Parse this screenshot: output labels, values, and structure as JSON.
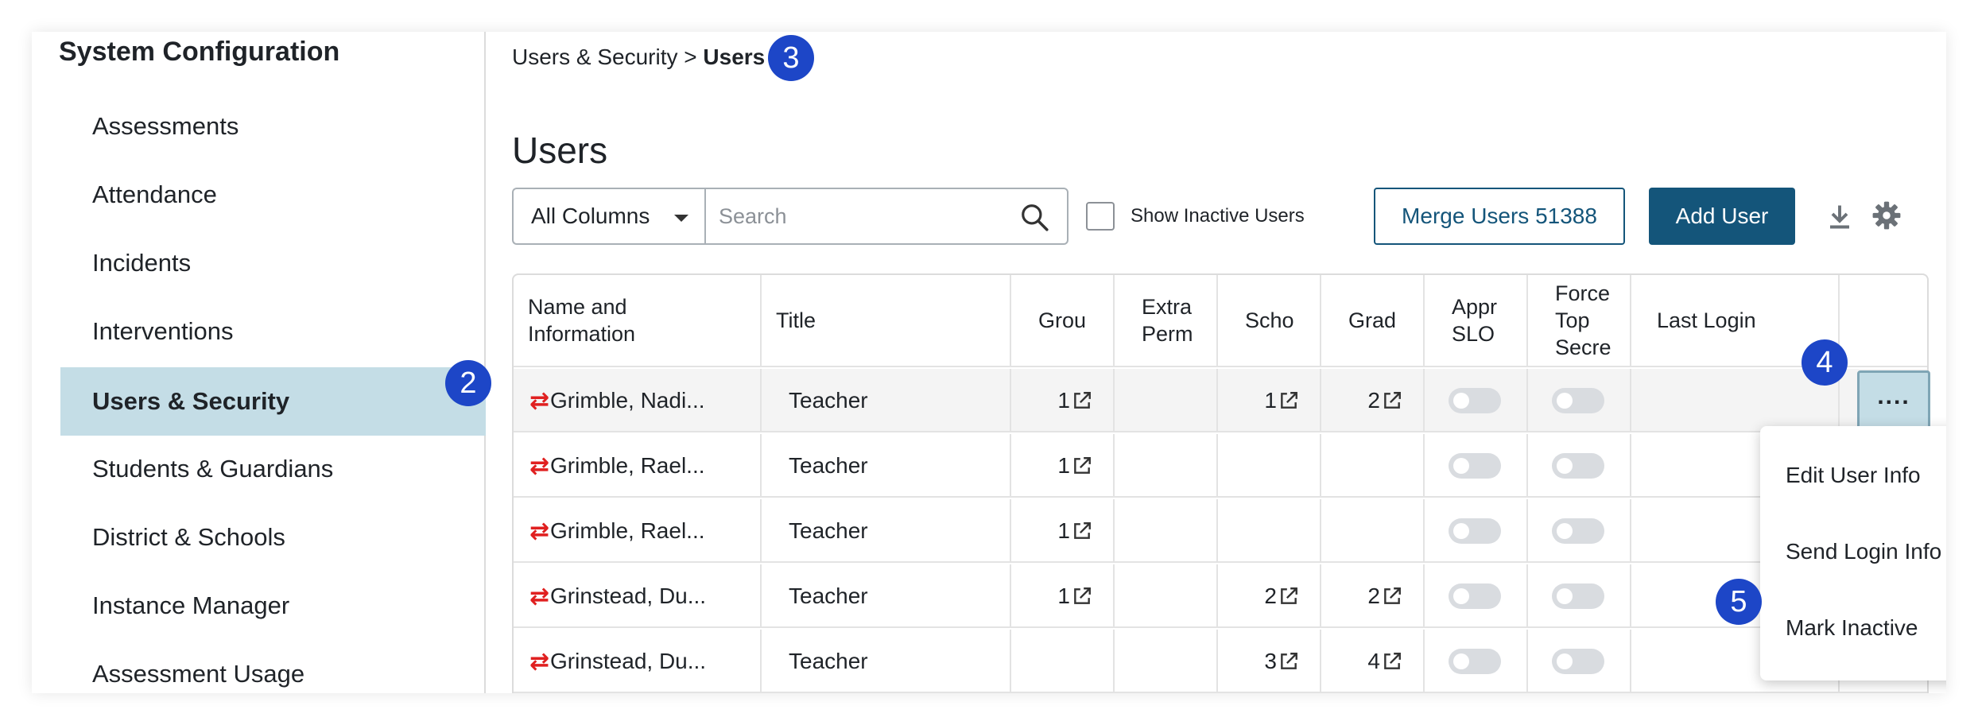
{
  "sidebar": {
    "title": "System Configuration",
    "items": [
      {
        "label": "Assessments"
      },
      {
        "label": "Attendance"
      },
      {
        "label": "Incidents"
      },
      {
        "label": "Interventions"
      },
      {
        "label": "Users & Security"
      },
      {
        "label": "Students & Guardians"
      },
      {
        "label": "District & Schools"
      },
      {
        "label": "Instance Manager"
      },
      {
        "label": "Assessment Usage"
      }
    ],
    "active_item": "Users & Security"
  },
  "breadcrumb": {
    "parent": "Users & Security",
    "separator": ">",
    "current": "Users"
  },
  "page_title": "Users",
  "toolbar": {
    "column_filter": "All Columns",
    "search_placeholder": "Search",
    "show_inactive_label": "Show Inactive Users",
    "merge_label": "Merge Users 51388",
    "add_label": "Add User"
  },
  "table": {
    "headers": [
      "Name and\nInformation",
      "Title",
      "Grou",
      "Extra\nPerm",
      "Scho",
      "Grad",
      "Appr\nSLO",
      "Force\nTop\nSecre",
      "Last Login"
    ],
    "rows": [
      {
        "name": "Grimble, Nadi...",
        "title": "Teacher",
        "groups": "1",
        "extra": "",
        "schools": "1",
        "grades": "2"
      },
      {
        "name": "Grimble, Rael...",
        "title": "Teacher",
        "groups": "1",
        "extra": "",
        "schools": "",
        "grades": ""
      },
      {
        "name": "Grimble, Rael...",
        "title": "Teacher",
        "groups": "1",
        "extra": "",
        "schools": "",
        "grades": ""
      },
      {
        "name": "Grinstead, Du...",
        "title": "Teacher",
        "groups": "1",
        "extra": "",
        "schools": "2",
        "grades": "2"
      },
      {
        "name": "Grinstead, Du...",
        "title": "Teacher",
        "groups": "",
        "extra": "",
        "schools": "3",
        "grades": "4"
      }
    ],
    "row_actions_label": "...."
  },
  "row_menu": {
    "items": [
      "Edit User Info",
      "Send Login Info",
      "Mark Inactive"
    ]
  },
  "badges": [
    "2",
    "3",
    "4",
    "5"
  ],
  "colors": {
    "accent": "#14557a",
    "active_nav": "#c4dde6",
    "badge": "#1d46c7",
    "merge_icon": "#e02020"
  }
}
